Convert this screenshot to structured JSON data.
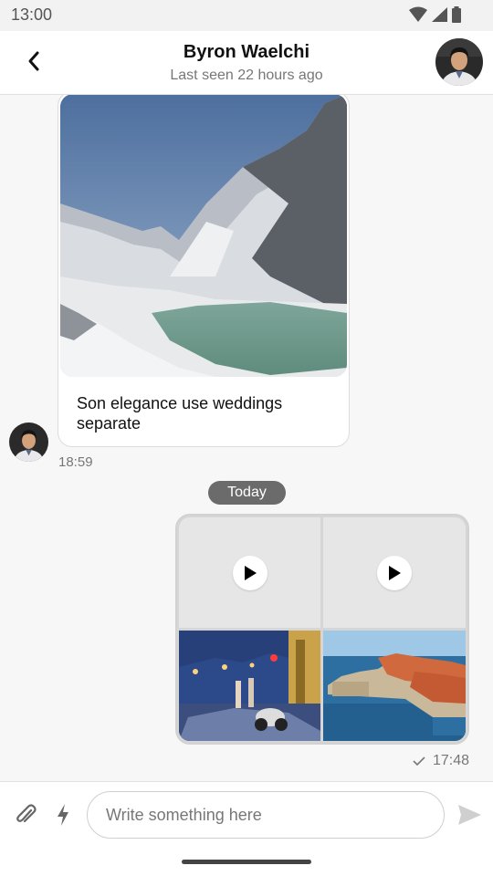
{
  "status_bar": {
    "time": "13:00",
    "icons": [
      "wifi-icon",
      "signal-icon",
      "battery-icon"
    ]
  },
  "header": {
    "contact_name": "Byron Waelchi",
    "last_seen": "Last seen 22 hours ago",
    "back_icon": "chevron-left-icon"
  },
  "messages": [
    {
      "type": "image",
      "direction": "incoming",
      "caption": "Son elegance use weddings separate",
      "time": "18:59"
    },
    {
      "type": "date_separator",
      "label": "Today"
    },
    {
      "type": "media_grid",
      "direction": "outgoing",
      "items": [
        "video",
        "video",
        "image",
        "image"
      ],
      "time": "17:48",
      "status_icon": "check-icon"
    }
  ],
  "composer": {
    "placeholder": "Write something here",
    "icons": [
      "paperclip-icon",
      "lightning-icon",
      "send-icon"
    ]
  },
  "colors": {
    "date_pill": "#6b6b6b",
    "bubble_border": "#dcdcdc",
    "background": "#f7f7f7"
  }
}
